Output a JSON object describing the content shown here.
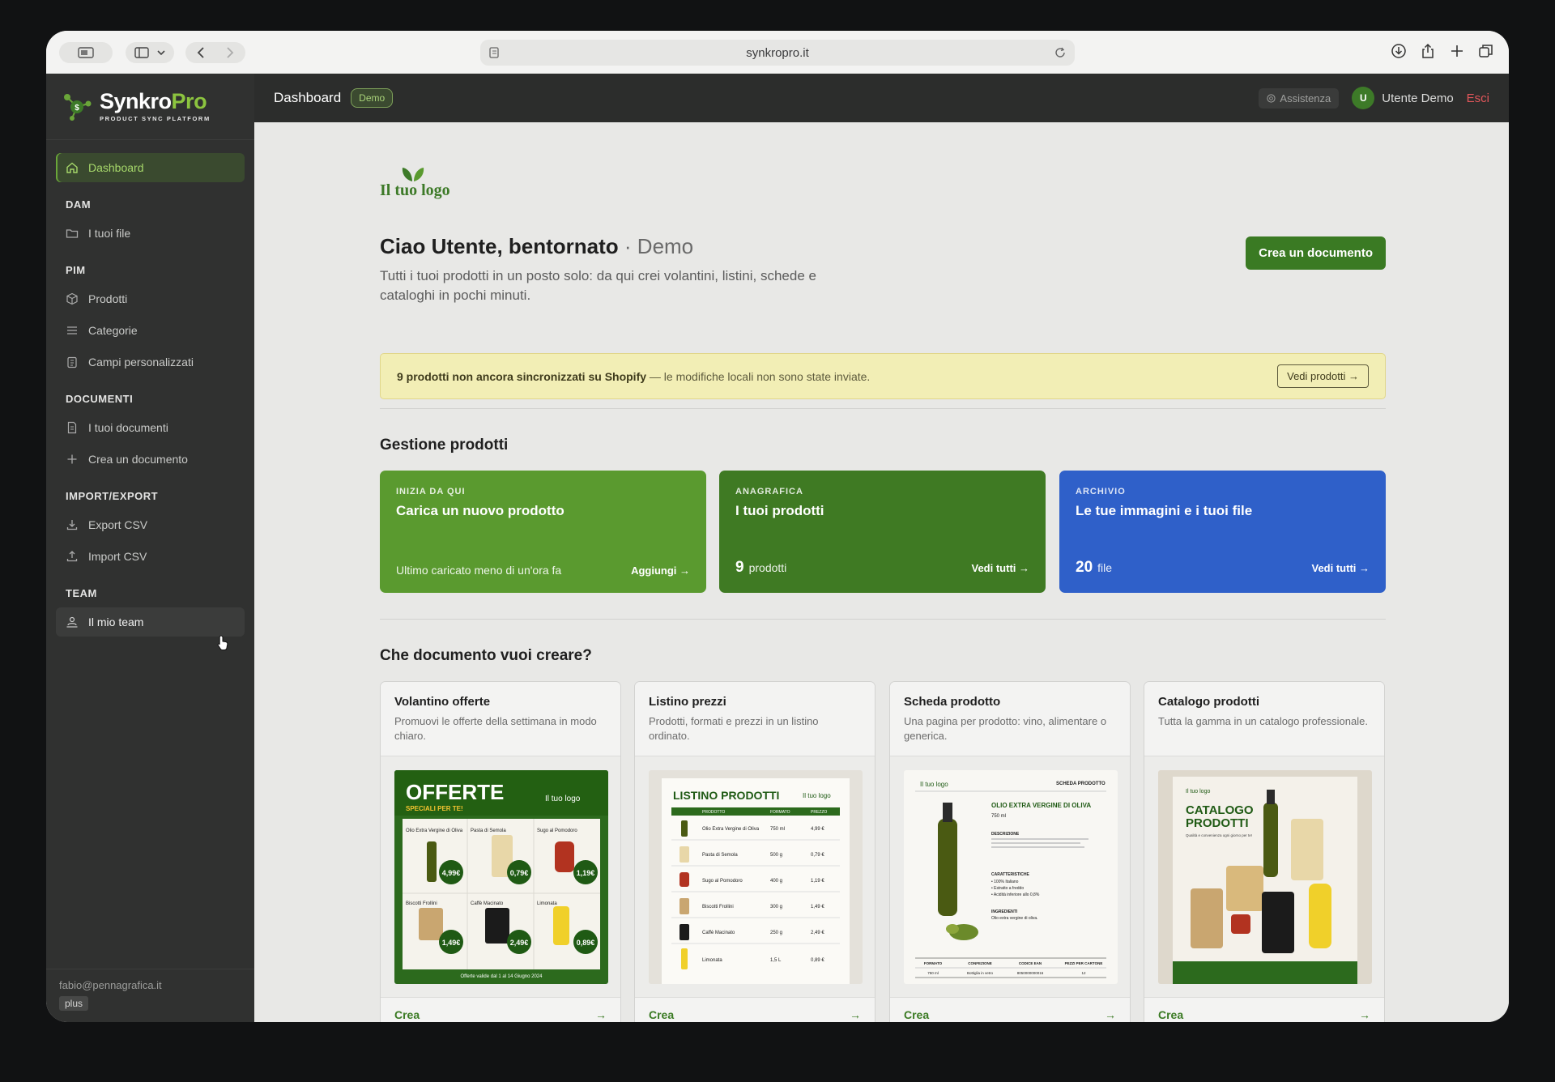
{
  "browser": {
    "url": "synkropro.it"
  },
  "brand": {
    "name_part1": "Synkro",
    "name_part2": "Pro",
    "tagline": "PRODUCT SYNC PLATFORM"
  },
  "sidebar": {
    "dashboard": "Dashboard",
    "sections": {
      "dam": "DAM",
      "pim": "PIM",
      "documenti": "DOCUMENTI",
      "import_export": "IMPORT/EXPORT",
      "team": "TEAM"
    },
    "items": {
      "files": "I tuoi file",
      "products": "Prodotti",
      "categories": "Categorie",
      "custom_fields": "Campi personalizzati",
      "documents": "I tuoi documenti",
      "create_document": "Crea un documento",
      "export_csv": "Export CSV",
      "import_csv": "Import CSV",
      "my_team": "Il mio team"
    },
    "footer": {
      "email": "fabio@pennagrafica.it",
      "plan": "plus"
    }
  },
  "appbar": {
    "title": "Dashboard",
    "badge": "Demo",
    "assist": "Assistenza",
    "avatar_initial": "U",
    "user_name": "Utente Demo",
    "logout": "Esci"
  },
  "main": {
    "logo_text": "Il tuo logo",
    "greeting": "Ciao Utente, bentornato",
    "greeting_sub": "· Demo",
    "intro": "Tutti i tuoi prodotti in un posto solo: da qui crei volantini, listini, schede e cataloghi in pochi minuti.",
    "create_button": "Crea un documento",
    "alert": {
      "bold": "9 prodotti non ancora sincronizzati su Shopify",
      "rest": " — le modifiche locali non sono state inviate.",
      "button": "Vedi prodotti →"
    },
    "products_section_title": "Gestione prodotti",
    "cards": [
      {
        "eyebrow": "INIZIA DA QUI",
        "title": "Carica un nuovo prodotto",
        "foot_text": "Ultimo caricato meno di un'ora fa",
        "action": "Aggiungi →",
        "color": "#5a9a2f"
      },
      {
        "eyebrow": "ANAGRAFICA",
        "title": "I tuoi prodotti",
        "count": "9",
        "unit": "prodotti",
        "action": "Vedi tutti →",
        "color": "#3f7a23"
      },
      {
        "eyebrow": "ARCHIVIO",
        "title": "Le tue immagini e i tuoi file",
        "count": "20",
        "unit": "file",
        "action": "Vedi tutti →",
        "color": "#2f60c9"
      }
    ],
    "docs_section_title": "Che documento vuoi creare?",
    "docs": [
      {
        "title": "Volantino offerte",
        "desc": "Promuovi le offerte della settimana in modo chiaro.",
        "action": "Crea"
      },
      {
        "title": "Listino prezzi",
        "desc": "Prodotti, formati e prezzi in un listino ordinato.",
        "action": "Crea"
      },
      {
        "title": "Scheda prodotto",
        "desc": "Una pagina per prodotto: vino, alimentare o generica.",
        "action": "Crea"
      },
      {
        "title": "Catalogo prodotti",
        "desc": "Tutta la gamma in un catalogo professionale.",
        "action": "Crea"
      }
    ],
    "previews": {
      "offerte_title": "OFFERTE",
      "offerte_sub": "SPECIALI PER TE!",
      "logo_small": "Il tuo logo",
      "offerte_items": [
        {
          "name": "Olio Extra Vergine di Oliva",
          "price": "4,99€"
        },
        {
          "name": "Pasta di Semola",
          "price": "0,79€"
        },
        {
          "name": "Sugo al Pomodoro",
          "price": "1,19€"
        },
        {
          "name": "Biscotti Frollini",
          "price": "1,49€"
        },
        {
          "name": "Caffè Macinato",
          "price": "2,49€"
        },
        {
          "name": "Limonata",
          "price": "0,89€"
        }
      ],
      "offerte_foot": "Offerte valide dal 1 al 14 Giugno 2024",
      "listino_title": "LISTINO PRODOTTI",
      "listino_headers": [
        "PRODOTTO",
        "FORMATO",
        "PREZZO"
      ],
      "listino_rows": [
        {
          "name": "Olio Extra Vergine di Oliva",
          "format": "750 ml",
          "price": "4,99 €"
        },
        {
          "name": "Pasta di Semola",
          "format": "500 g",
          "price": "0,79 €"
        },
        {
          "name": "Sugo al Pomodoro",
          "format": "400 g",
          "price": "1,19 €"
        },
        {
          "name": "Biscotti Frollini",
          "format": "300 g",
          "price": "1,49 €"
        },
        {
          "name": "Caffè Macinato",
          "format": "250 g",
          "price": "2,49 €"
        },
        {
          "name": "Limonata",
          "format": "1,5 L",
          "price": "0,89 €"
        }
      ],
      "scheda_label": "SCHEDA PRODOTTO",
      "scheda_title": "OLIO EXTRA VERGINE DI OLIVA",
      "scheda_size": "750 ml",
      "scheda_desc_h": "DESCRIZIONE",
      "scheda_char_h": "CARATTERISTICHE",
      "scheda_chars": [
        "• 100% Italiano",
        "• Estratto a freddo",
        "• Acidità inferiore allo 0,8%"
      ],
      "scheda_ingr_h": "INGREDIENTI",
      "scheda_ingr": "Olio extra vergine di oliva.",
      "scheda_table_h": [
        "FORMATO",
        "CONFEZIONE",
        "CODICE EAN",
        "PEZZI PER CARTONE"
      ],
      "scheda_table_v": [
        "750 ml",
        "Bottiglia in vetro",
        "8050000000016",
        "12"
      ],
      "catalogo_title": "CATALOGO PRODOTTI",
      "catalogo_sub": "Qualità e convenienza ogni giorno per te!"
    }
  }
}
